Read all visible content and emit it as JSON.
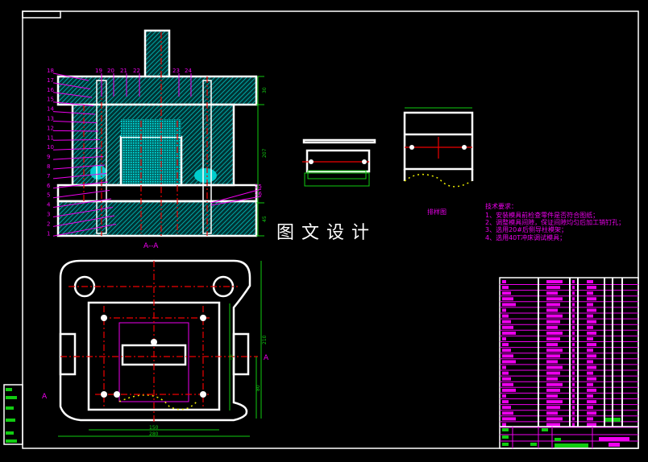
{
  "drawing": {
    "title": "图文设计",
    "section_label": "A--A",
    "section_marker": "A",
    "layout_label": "排样图",
    "part_labels_left": [
      "18",
      "17",
      "16",
      "15",
      "14",
      "13",
      "12",
      "11",
      "10",
      "9",
      "8",
      "7",
      "6",
      "5",
      "4",
      "3",
      "2",
      "1"
    ],
    "part_labels_top": [
      "19",
      "20",
      "21",
      "22",
      "23",
      "24"
    ],
    "part_labels_right": [
      "25",
      "26"
    ],
    "dimensions": {
      "section_top": "30",
      "section_height": "207",
      "section_bottom": "45",
      "plan_inner_width": "150",
      "plan_outer_width": "280",
      "plan_height": "210",
      "plan_half": "80"
    },
    "technical_requirements": {
      "heading": "技术要求：",
      "items": [
        "1、安装模具前检查零件是否符合图纸；",
        "2、调整模具间隙，保证间隙均匀后加工销钉孔；",
        "3、选用20#后侧导柱模架；",
        "4、选用40T冲床调试模具；"
      ]
    }
  },
  "colors": {
    "outline": "#ffffff",
    "center": "#ee0000",
    "dimension": "#11cc11",
    "label": "#ee00ee",
    "hatch": "#00cccc"
  }
}
